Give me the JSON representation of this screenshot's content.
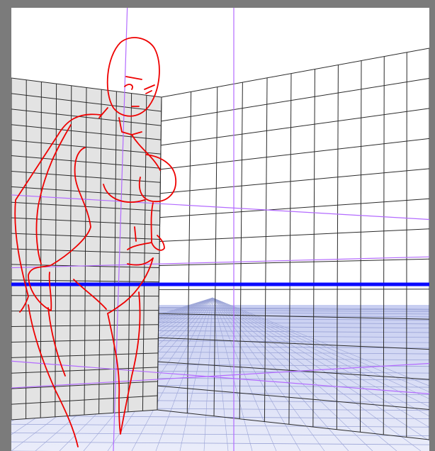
{
  "app": {
    "window_title": "",
    "view": "perspective-ruler-canvas"
  },
  "colors": {
    "workspace_bg": "#7b7b7b",
    "canvas_bg": "#ffffff",
    "left_wall_fill": "#e3e3e3",
    "grid_line": "#2b2b2b",
    "floor_grid": "#9aa3d6",
    "horizon_band": "#c4cbf0",
    "eye_level": "#0a0aff",
    "guide_line": "#b36bff",
    "sketch_stroke": "#ee0000"
  },
  "rulers": {
    "eye_level_label": "",
    "guides_count_label": ""
  }
}
